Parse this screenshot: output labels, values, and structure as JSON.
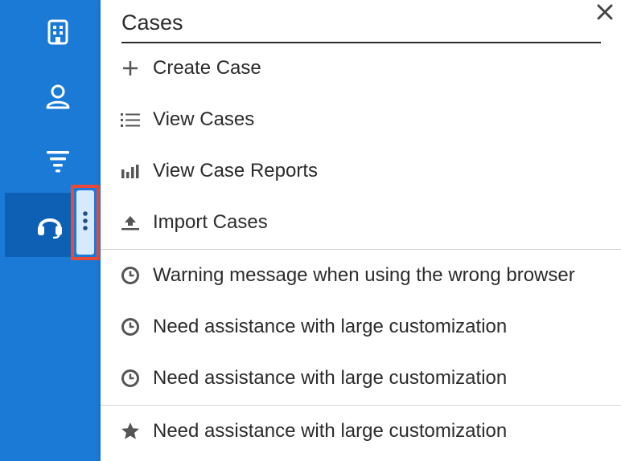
{
  "sidebar": {
    "items": [
      {
        "icon": "building-icon"
      },
      {
        "icon": "contact-icon"
      },
      {
        "icon": "filter-icon"
      },
      {
        "icon": "headset-icon",
        "active": true
      }
    ],
    "more_icon": "more-vertical-icon"
  },
  "menu": {
    "title": "Cases",
    "close_icon": "close-icon",
    "actions": [
      {
        "label": "Create Case",
        "icon": "plus-icon"
      },
      {
        "label": "View Cases",
        "icon": "list-icon"
      },
      {
        "label": "View Case Reports",
        "icon": "bar-chart-icon"
      },
      {
        "label": "Import Cases",
        "icon": "upload-icon"
      }
    ],
    "recent": [
      {
        "label": "Warning message when using the wrong browser",
        "icon": "clock-icon"
      },
      {
        "label": "Need assistance with large customization",
        "icon": "clock-icon"
      },
      {
        "label": "Need assistance with large customization",
        "icon": "clock-icon"
      }
    ],
    "favorites": [
      {
        "label": "Need assistance with large customization",
        "icon": "star-icon"
      }
    ]
  },
  "colors": {
    "sidebar": "#1a7ad6",
    "sidebar_active": "#0d60b3",
    "highlight_border": "#e8493b",
    "text": "#2b2b2b",
    "icon": "#555555"
  }
}
